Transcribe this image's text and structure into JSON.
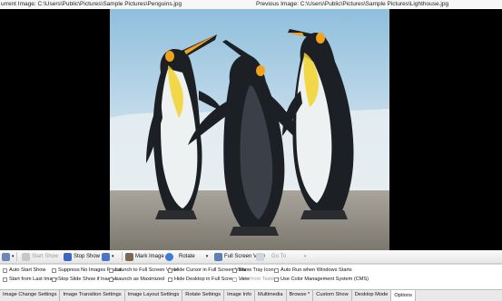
{
  "header": {
    "current_image": "urrent Image: C:\\Users\\Public\\Pictures\\Sample Pictures\\Penguins.jpg",
    "previous_image": "Previous Image: C:\\Users\\Public\\Pictures\\Sample Pictures\\Lighthouse.jpg"
  },
  "toolbar": {
    "start_show": "Start Show",
    "stop_show": "Stop Show",
    "mark_image": "Mark Image",
    "rotate": "Rotate",
    "full_screen_view": "Full Screen View",
    "go_to": "Go To",
    "icons": [
      "settings-icon",
      "play-icon",
      "stop-icon",
      "next-icon",
      "mark-icon",
      "rotate-icon",
      "fullscreen-icon",
      "goto-icon"
    ]
  },
  "options": {
    "auto_start_show": "Auto Start Show",
    "start_from_last_image": "Start from Last Image",
    "suppress_no_images_found": "Suppress No Images Found",
    "stop_slide_show_if_inactive": "Stop Slide Show if Inactive",
    "launch_to_full_screen_view": "Launch to Full Screen View",
    "launch_as_maximized": "Launch as Maximized",
    "hide_cursor_full_screen": "Hide Cursor in Full Screen View",
    "hide_desktop_full_screen": "Hide Desktop in Full Screen View",
    "show_tray_icon": "Show Tray Icon",
    "hide_from_taskbar": "Hide from Taskbar",
    "auto_run_windows": "Auto Run when Windows Starts",
    "use_color_management": "Use Color Management System (CMS)"
  },
  "tabs": [
    "Image Change Settings",
    "Image Transition Settings",
    "Image Layout Settings",
    "Rotate Settings",
    "Image Info",
    "Multimedia",
    "Browse *",
    "Custom Show",
    "Desktop Mode",
    "Options"
  ],
  "colors": {
    "sky": "#9cc6e0",
    "ice": "#dde6ec",
    "sand": "#8f8c84",
    "penguin_black": "#1c1f24",
    "penguin_white": "#eceff0",
    "penguin_orange": "#f2a31b"
  }
}
